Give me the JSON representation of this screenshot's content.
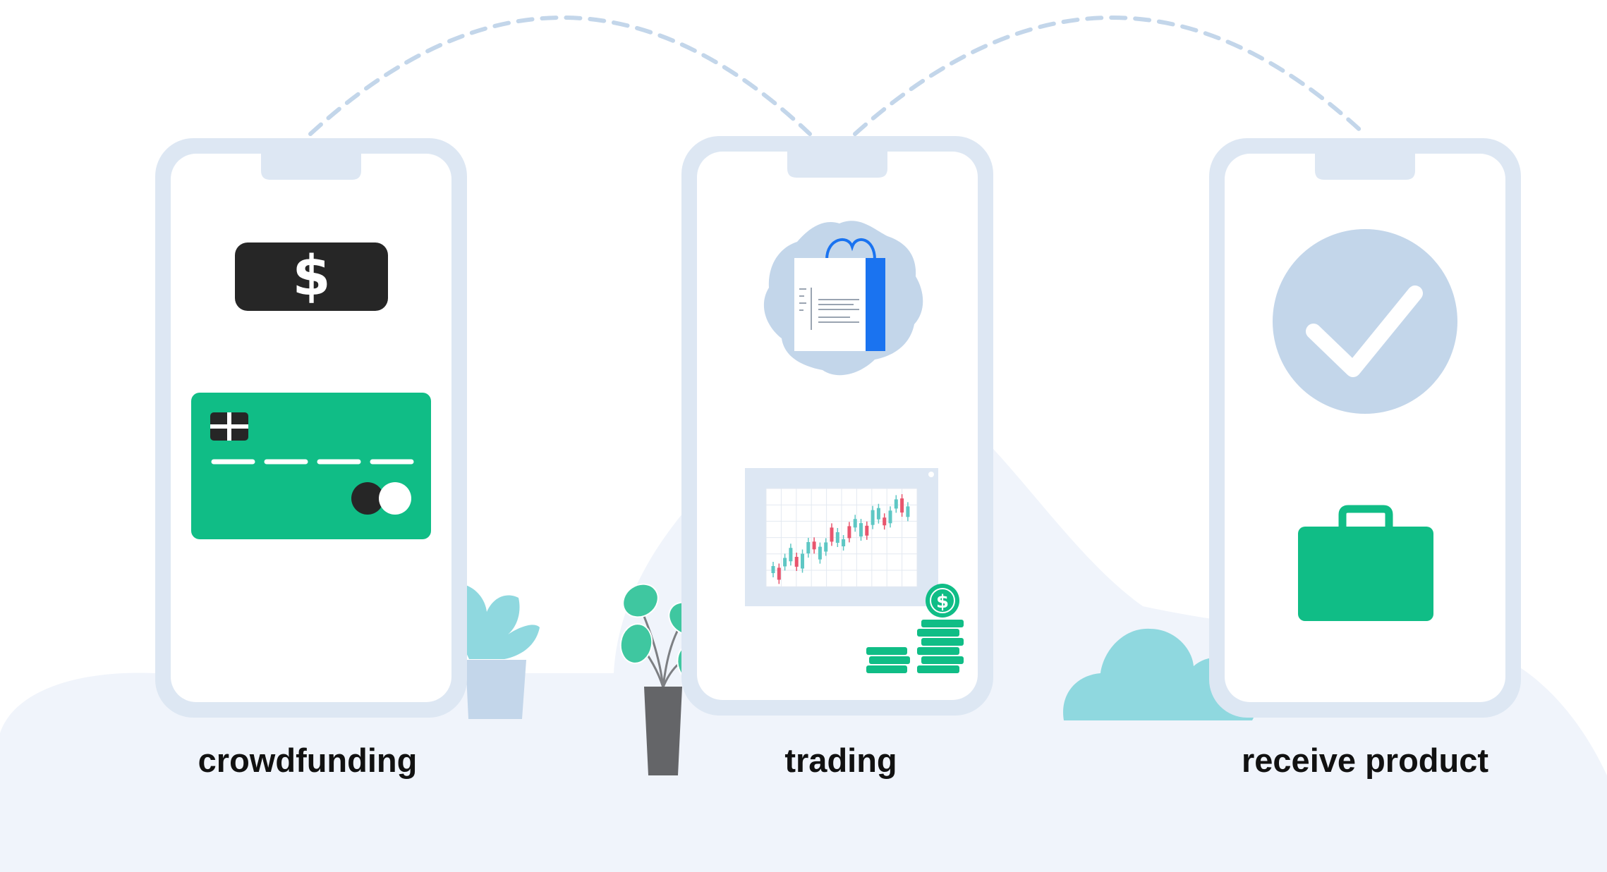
{
  "steps": [
    {
      "label": "crowdfunding",
      "icons": [
        "dollar-banknote-icon",
        "credit-card-icon"
      ]
    },
    {
      "label": "trading",
      "icons": [
        "shopping-bag-icon",
        "candlestick-chart-icon",
        "coin-stack-icon"
      ]
    },
    {
      "label": "receive product",
      "icons": [
        "checkmark-icon",
        "briefcase-icon"
      ]
    }
  ],
  "colors": {
    "phone_frame": "#dde7f3",
    "background_hill": "#f0f4fb",
    "connector_dash": "#c3d6ea",
    "banknote": "#262626",
    "accent_green": "#10bd86",
    "check_circle": "#c3d6ea",
    "bag_blue": "#1a73f0",
    "plant_teal": "#8fd8df",
    "candle_red": "#e8556d",
    "candle_teal": "#5ec7c4"
  }
}
